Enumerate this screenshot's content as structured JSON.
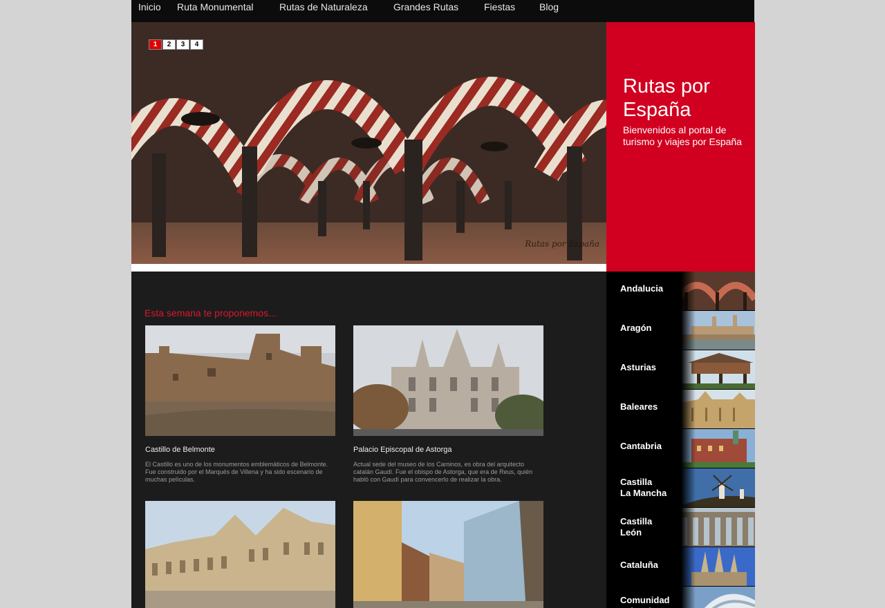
{
  "nav": {
    "items": [
      {
        "label": "Inicio"
      },
      {
        "label": "Ruta Monumental"
      },
      {
        "label": "Rutas de Naturaleza"
      },
      {
        "label": "Grandes Rutas"
      },
      {
        "label": "Fiestas"
      },
      {
        "label": "Blog"
      }
    ]
  },
  "hero": {
    "pager": [
      "1",
      "2",
      "3",
      "4"
    ],
    "active_page": 1,
    "caption": "Rutas por España"
  },
  "promo": {
    "title": "Rutas por España",
    "subtitle": "Bienvenidos al portal de turismo y viajes por España"
  },
  "main": {
    "section_title": "Esta semana te proponemos...",
    "cards": [
      {
        "title": "Castillo de Belmonte",
        "description": "El Castillo es uno de los monumentos emblemáticos de Belmonte. Fue construido por el Marqués de Villena y ha sido escenario de muchas películas."
      },
      {
        "title": "Palacio Episcopal de Astorga",
        "description": "Actual sede del museo de los Caminos, es obra del arquitecto catalán Gaudí. Fue el obispo de Astorga, que era de Reus, quién habló con Gaudí para convencerlo de realizar la obra."
      },
      {
        "title": "",
        "description": ""
      },
      {
        "title": "",
        "description": ""
      }
    ]
  },
  "regions": [
    {
      "label": "Andalucia"
    },
    {
      "label": "Aragón"
    },
    {
      "label": "Asturias"
    },
    {
      "label": "Baleares"
    },
    {
      "label": "Cantabria"
    },
    {
      "label": "Castilla\nLa Mancha"
    },
    {
      "label": "Castilla\nLeón"
    },
    {
      "label": "Cataluña"
    },
    {
      "label": "Comunidad\nValenciana"
    }
  ],
  "colors": {
    "accent_red": "#d10020",
    "nav_bg": "#0c0c0c",
    "main_bg": "#1c1c1c",
    "page_bg": "#d4d4d4"
  }
}
